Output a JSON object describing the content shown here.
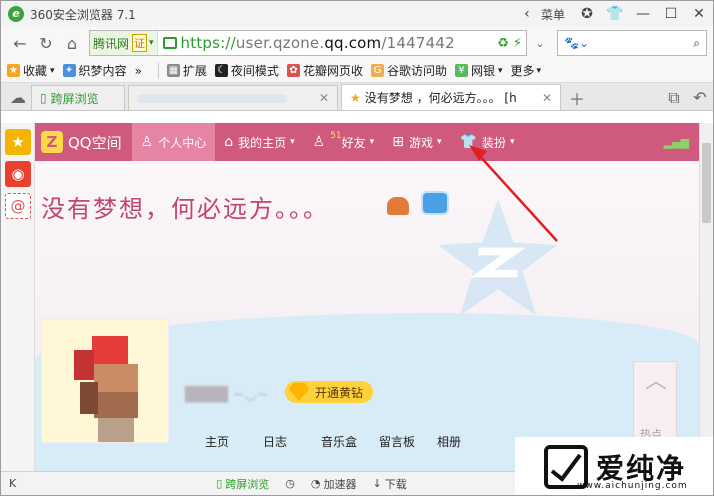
{
  "window": {
    "title": "360安全浏览器 7.1",
    "menu_label": "菜单"
  },
  "address_bar": {
    "cert_name": "腾讯网",
    "cert_badge": "证",
    "url_scheme": "https://",
    "url_pre": "user.qzone.",
    "url_domain": "qq.com",
    "url_rest": "/1447442"
  },
  "bookmarks": [
    {
      "label": "收藏",
      "color": "#f5a623"
    },
    {
      "label": "织梦内容",
      "color": "#4a90e2"
    },
    {
      "label": "扩展",
      "color": "#8a8a8a"
    },
    {
      "label": "夜间模式",
      "color": "#222222"
    },
    {
      "label": "花瓣网页收",
      "color": "#d9534f"
    },
    {
      "label": "谷歌访问助",
      "color": "#f0ad4e"
    },
    {
      "label": "网银",
      "color": "#5cb85c"
    },
    {
      "label": "更多",
      "color": "#888888"
    }
  ],
  "tabs": [
    {
      "label": "跨屏浏览"
    },
    {
      "label": ""
    },
    {
      "label": "没有梦想 ，何必远方。。。 [h"
    }
  ],
  "qzone": {
    "logo": "QQ空间",
    "nav": [
      {
        "label": "个人中心",
        "icon": "user-icon"
      },
      {
        "label": "我的主页",
        "icon": "home-icon"
      },
      {
        "label": "好友",
        "icon": "friends-icon",
        "badge": "51"
      },
      {
        "label": "游戏",
        "icon": "grid-icon"
      },
      {
        "label": "装扮",
        "icon": "shirt-icon"
      }
    ],
    "motto": "没有梦想，何必远方。。。",
    "vip_label": "开通黄钻",
    "profile_nav": [
      "主页",
      "日志",
      "音乐盒",
      "留言板",
      "相册"
    ],
    "side_label": "热点"
  },
  "status_bar": {
    "items": [
      "跨屏浏览",
      "加速器",
      "下载"
    ]
  },
  "watermark": {
    "text": "爱纯净",
    "sub": "www.aichunjing.com"
  }
}
